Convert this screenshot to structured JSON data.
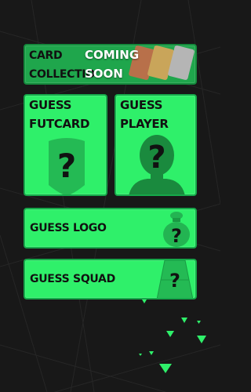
{
  "menu": {
    "card_collection": {
      "line1": "CARD",
      "line2": "COLLECTION",
      "badge_line1": "COMING",
      "badge_line2": "SOON"
    },
    "guess_futcard": {
      "line1": "GUESS",
      "line2": "FUTCARD",
      "art_glyph": "?"
    },
    "guess_player": {
      "line1": "GUESS",
      "line2": "PLAYER",
      "art_glyph": "?"
    },
    "guess_logo": {
      "label": "GUESS LOGO",
      "art_glyph": "?"
    },
    "guess_squad": {
      "label": "GUESS SQUAD",
      "art_glyph": "?"
    }
  },
  "icons": [
    "card-stack-icon",
    "card-silhouette-icon",
    "player-silhouette-icon",
    "money-bag-icon",
    "pitch-icon"
  ],
  "colors": {
    "background": "#181818",
    "tile_green": "#2ff06a",
    "tile_border": "#16a84a",
    "disabled_green": "#1fa64c",
    "accent_dark": "#111111"
  }
}
